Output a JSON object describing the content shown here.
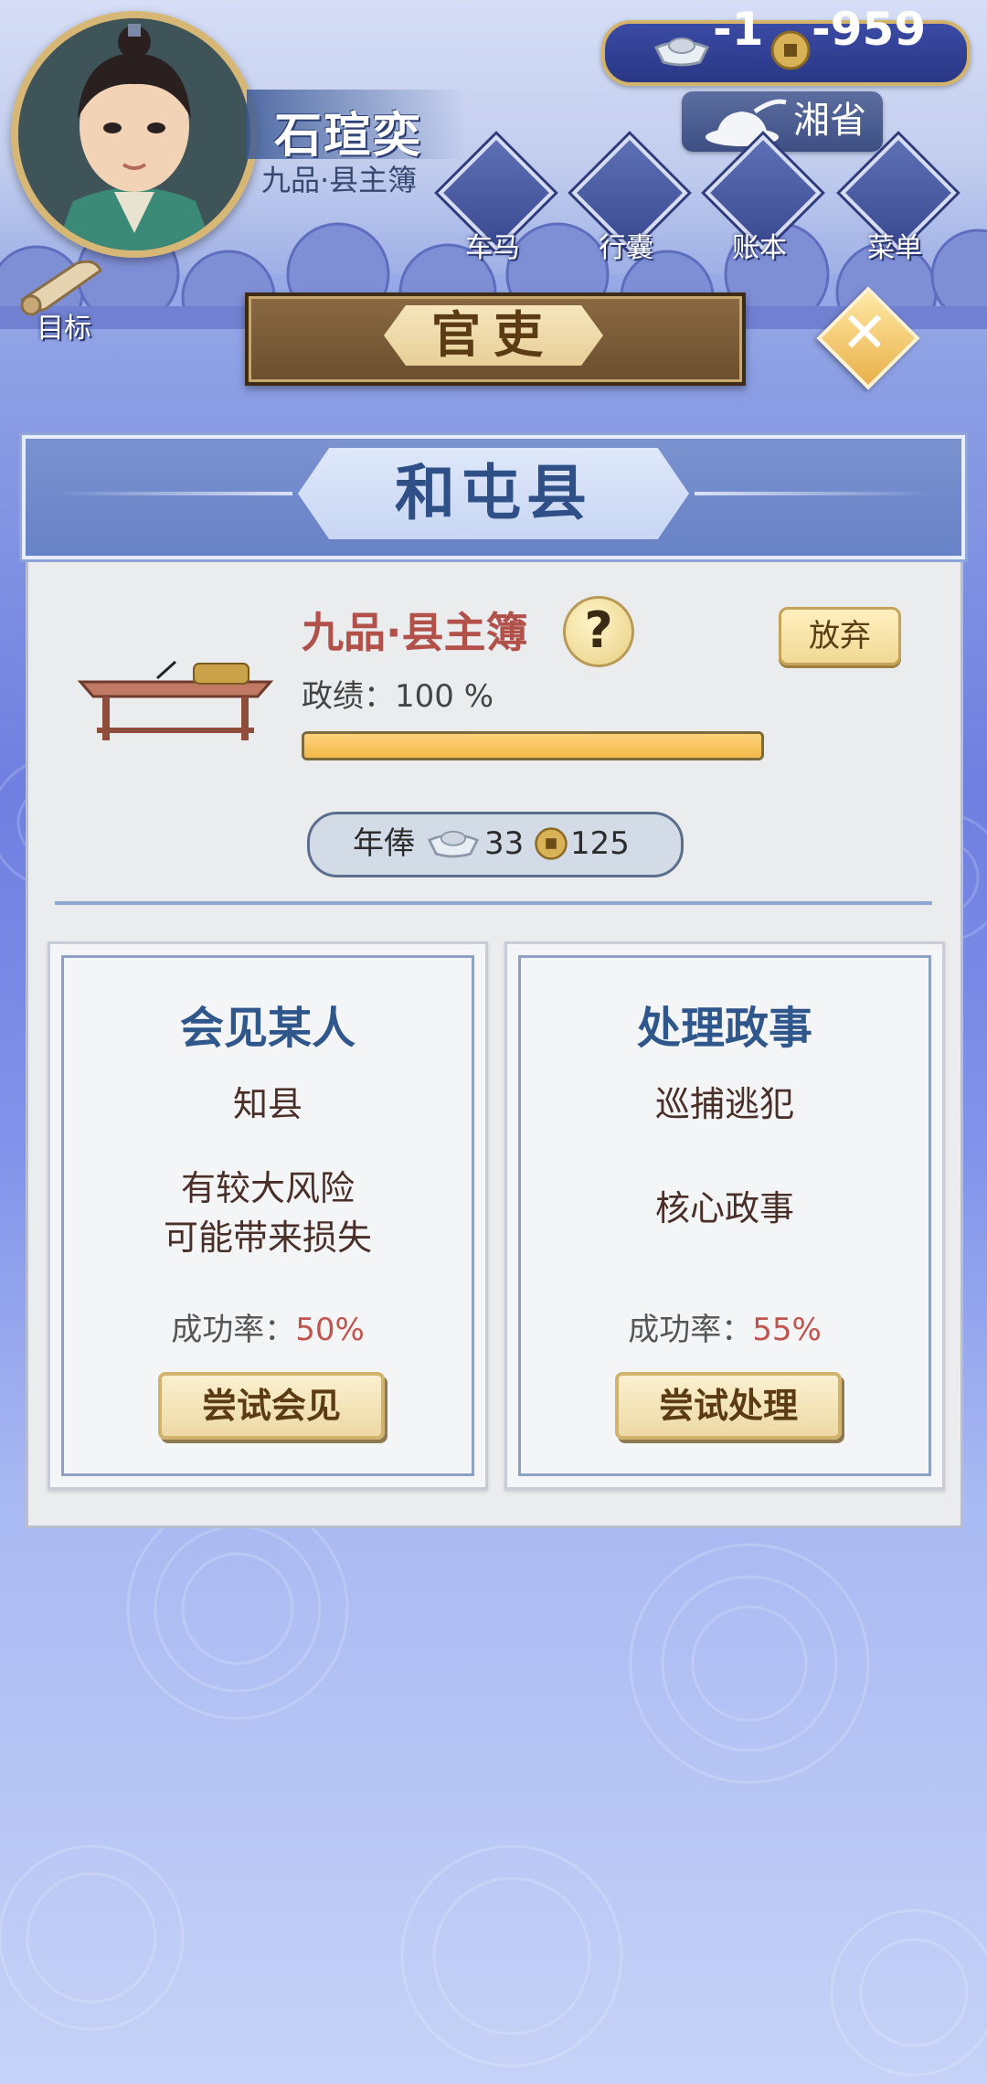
{
  "player": {
    "name": "石瑄奕",
    "rank": "九品·县主簿"
  },
  "currency": {
    "silver": "-1",
    "copper": "-959"
  },
  "province": "湘省",
  "nav": {
    "carriage": "车马",
    "luggage": "行囊",
    "ledger": "账本",
    "menu": "菜单",
    "goal": "目标"
  },
  "page_title": "官吏",
  "post": {
    "county": "和屯县",
    "title": "九品·县主簿",
    "help_icon_text": "?",
    "abandon_label": "放弃",
    "merit_label": "政绩：100 %",
    "merit_progress": 1.0,
    "salary_label": "年俸",
    "salary_silver": "33",
    "salary_copper": "125"
  },
  "tasks": [
    {
      "title": "会见某人",
      "target": "知县",
      "desc_line1": "有较大风险",
      "desc_line2": "可能带来损失",
      "rate_label": "成功率：",
      "rate_value": "50%",
      "button": "尝试会见"
    },
    {
      "title": "处理政事",
      "target": "巡捕逃犯",
      "desc_line1": "核心政事",
      "rate_label": "成功率：",
      "rate_value": "55%",
      "button": "尝试处理"
    }
  ],
  "colors": {
    "rank_red": "#b2504a",
    "task_blue": "#2f578c",
    "gold_border": "#d4b46a"
  }
}
